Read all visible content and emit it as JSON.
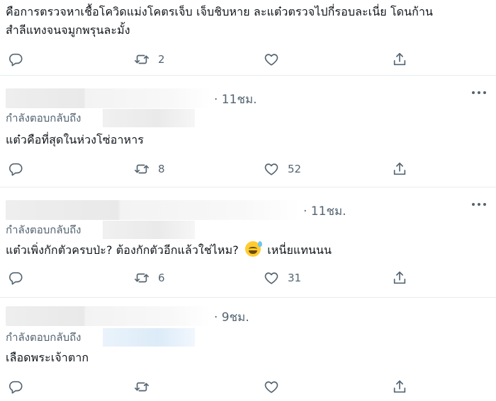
{
  "tweets": [
    {
      "text_line1": "คือการตรวจหาเชื้อโควิดแม่งโคตรเจ็บ เจ็บชิบหาย ละแต๋วตรวจไปกี่รอบละเนี่ย โดนก้าน",
      "text_line2": "สำลีแทงจนจมูกพรุนละมั้ง",
      "replies": "",
      "retweets": "2",
      "likes": ""
    },
    {
      "time": "· 11ชม.",
      "reply_prefix": "กำลังตอบกลับถึง",
      "text": "แต๋วคือที่สุดในห่วงโซ่อาหาร",
      "replies": "",
      "retweets": "8",
      "likes": "52"
    },
    {
      "time": "· 11ชม.",
      "reply_prefix": "กำลังตอบกลับถึง",
      "text_before_emoji": "แต๋วเพิ่งกักตัวครบป่ะ? ต้องกักตัวอีกแล้วใช่ไหม?",
      "emoji": "grinning-sweat-emoji",
      "text_after_emoji": "เหนี่ยแทนนน",
      "replies": "",
      "retweets": "6",
      "likes": "31"
    },
    {
      "time": "· 9ชม.",
      "reply_prefix": "กำลังตอบกลับถึง",
      "text": "เลือดพระเจ้าตาก",
      "replies": "",
      "retweets": "",
      "likes": ""
    }
  ],
  "icons": {
    "reply": "reply-icon",
    "retweet": "retweet-icon",
    "like": "heart-icon",
    "share": "share-icon",
    "more": "more-icon"
  },
  "colors": {
    "text": "#0f1419",
    "secondary": "#536471",
    "divider": "#e6ecf0"
  }
}
